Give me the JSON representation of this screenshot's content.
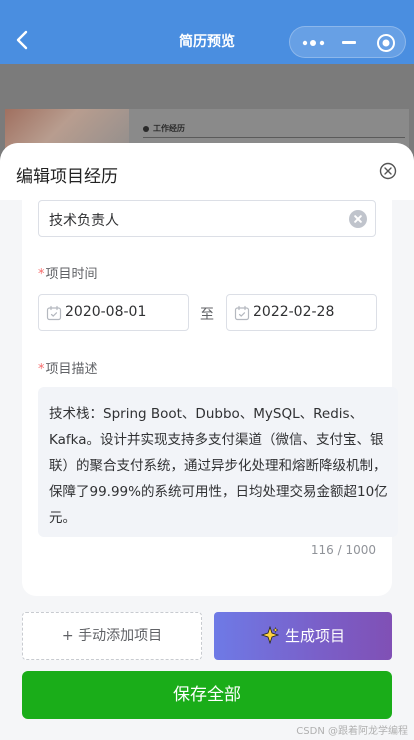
{
  "topbar": {
    "title": "简历预览",
    "back_icon": "chevron-left-icon",
    "capsule_icons": [
      "more-dots-icon",
      "minimize-icon",
      "target-icon"
    ],
    "color": "#4a8ee0"
  },
  "background_preview": {
    "section_label": "工作经历"
  },
  "sheet": {
    "title": "编辑项目经历",
    "close_icon": "close-circle-icon"
  },
  "form": {
    "role_value": "技术负责人",
    "time_label": "项目时间",
    "start_date": "2020-08-01",
    "date_separator": "至",
    "end_date": "2022-02-28",
    "desc_label": "项目描述",
    "description": "技术栈：Spring Boot、Dubbo、MySQL、Redis、Kafka。设计并实现支持多支付渠道（微信、支付宝、银联）的聚合支付系统，通过异步化处理和熔断降级机制，保障了99.99%的系统可用性，日均处理交易金额超10亿元。",
    "char_count": "116 / 1000",
    "required_mark": "*"
  },
  "actions": {
    "manual_add": "+ 手动添加项目",
    "ai_generate": "生成项目",
    "save_all": "保存全部",
    "save_color": "#1aad19"
  },
  "watermark": "CSDN @跟着阿龙学编程"
}
